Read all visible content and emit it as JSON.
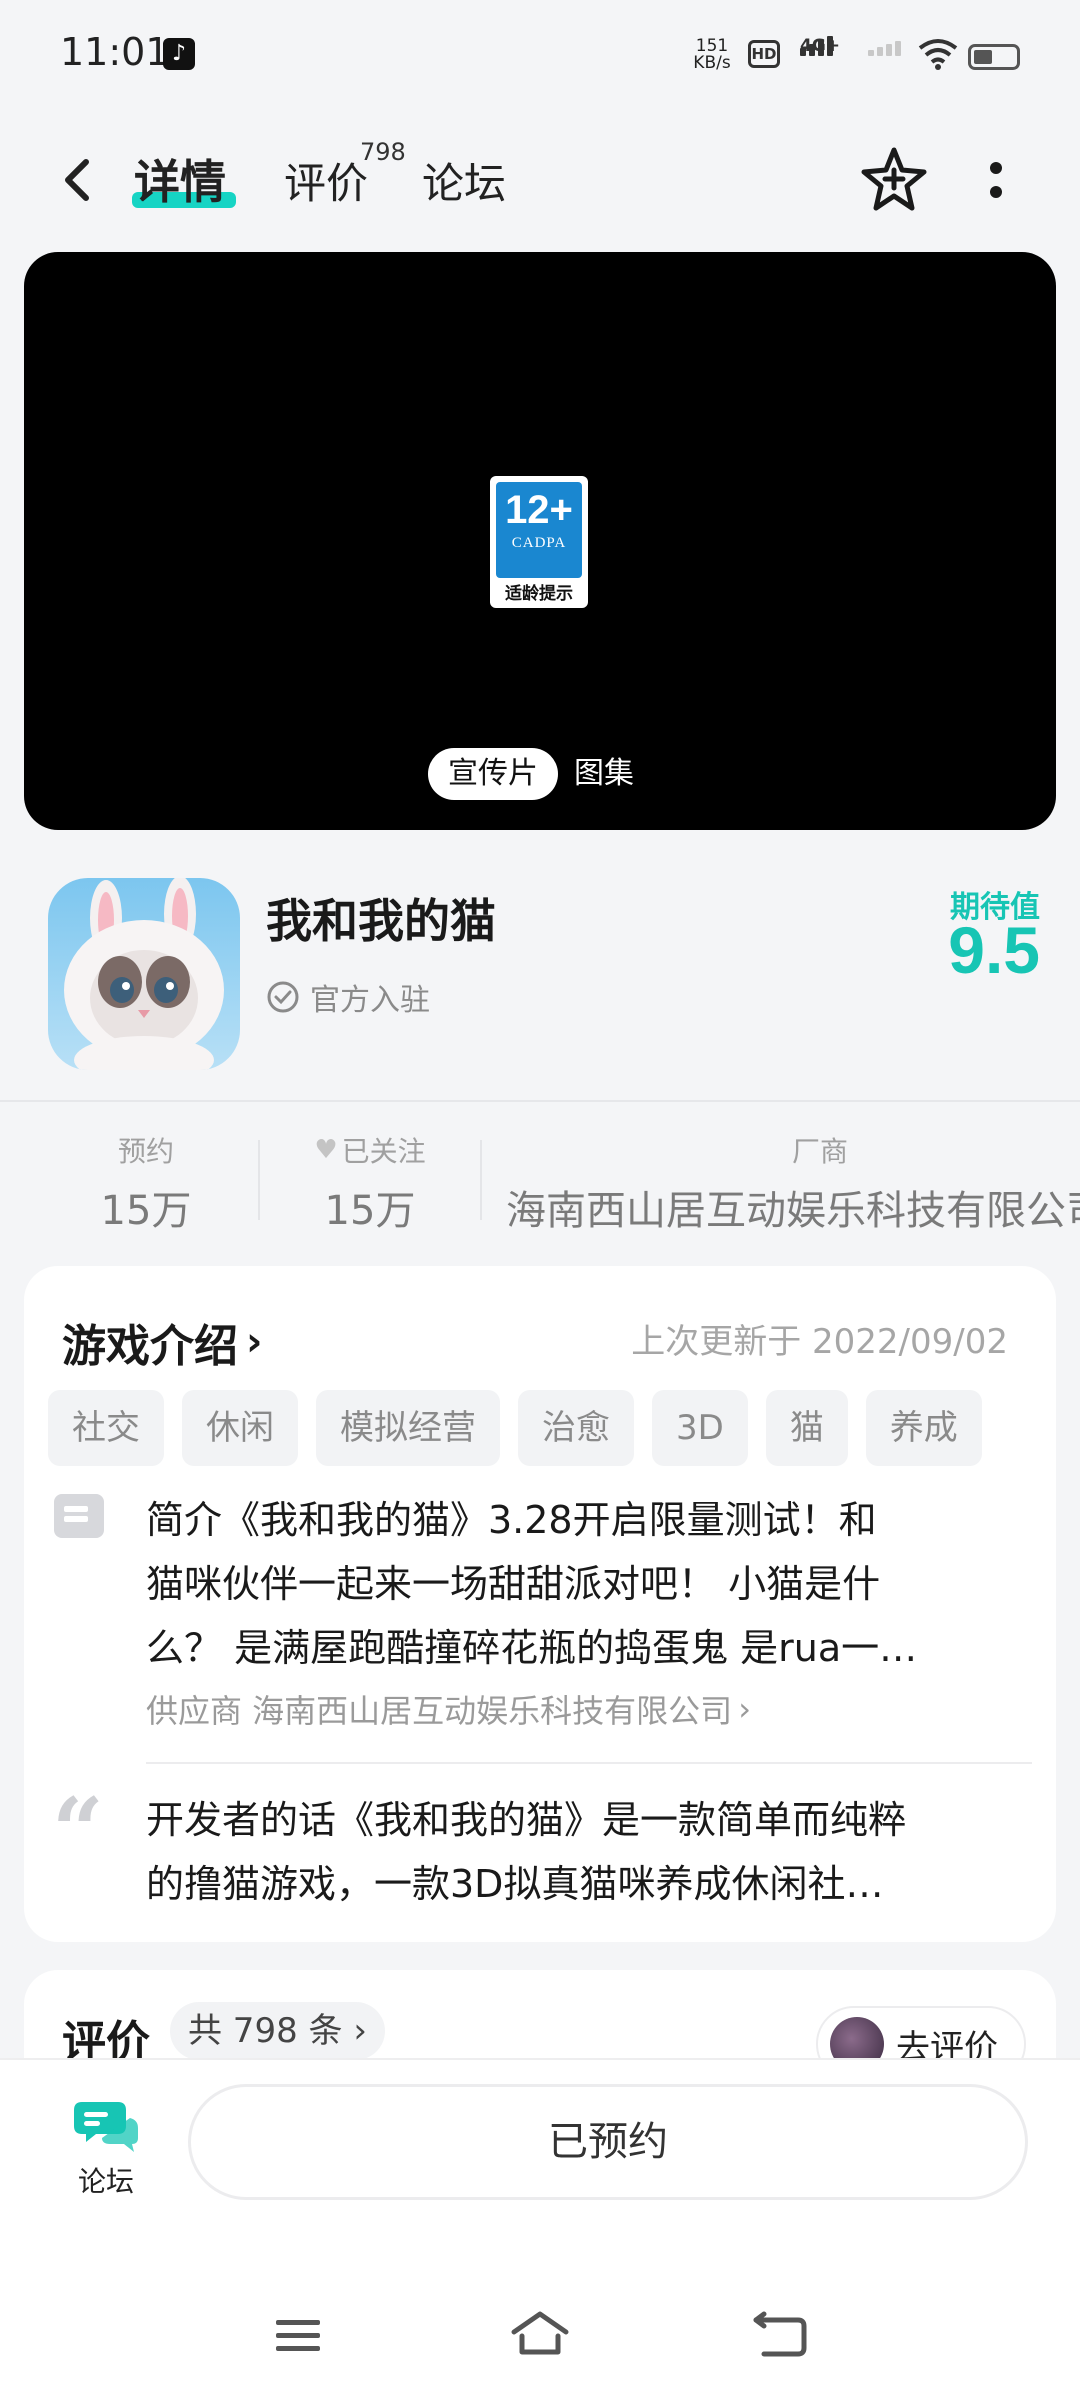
{
  "status_bar": {
    "time": "11:01",
    "net_speed_value": "151",
    "net_speed_unit": "KB/s",
    "hd_label": "HD",
    "network_label": "4G+",
    "icons": [
      "tiktok-icon",
      "hd-icon",
      "signal-icon",
      "wifi-icon",
      "battery-icon"
    ]
  },
  "nav": {
    "tabs": [
      {
        "label": "详情",
        "active": true
      },
      {
        "label": "评价",
        "badge": "798"
      },
      {
        "label": "论坛"
      }
    ],
    "icons": [
      "back-arrow-icon",
      "star-icon",
      "more-icon"
    ]
  },
  "media": {
    "age_rating": "12+",
    "age_org": "CADPA",
    "age_caption": "适龄提示",
    "tabs": [
      "宣传片",
      "图集"
    ]
  },
  "app": {
    "name": "我和我的猫",
    "official_label": "官方入驻",
    "expectation_label": "期待值",
    "expectation_value": "9.5"
  },
  "stats": {
    "reservations_label": "预约",
    "reservations_value": "15万",
    "followed_label": "已关注",
    "followed_value": "15万",
    "vendor_label": "厂商",
    "vendor_value": "海南西山居互动娱乐科技有限公司"
  },
  "intro": {
    "title": "游戏介绍",
    "updated": "上次更新于 2022/09/02",
    "tags": [
      "社交",
      "休闲",
      "模拟经营",
      "治愈",
      "3D",
      "猫",
      "养成"
    ],
    "summary_lines": [
      "简介《我和我的猫》3.28开启限量测试！和",
      "猫咪伙伴一起来一场甜甜派对吧！ 小猫是什",
      "么？ 是满屋跑酷撞碎花瓶的捣蛋鬼 是rua一…"
    ],
    "supplier": "供应商 海南西山居互动娱乐科技有限公司",
    "developer_lines": [
      "开发者的话《我和我的猫》是一款简单而纯粹",
      "的撸猫游戏，一款3D拟真猫咪养成休闲社…"
    ]
  },
  "rating": {
    "title": "评价",
    "count_label": "共 798 条",
    "go_rate_label": "去评价"
  },
  "bottom_bar": {
    "forum_label": "论坛",
    "reserved_label": "已预约"
  },
  "colors": {
    "accent": "#17c5b4",
    "tab_underline": "#16d4c4",
    "age_badge": "#1a87d0"
  }
}
